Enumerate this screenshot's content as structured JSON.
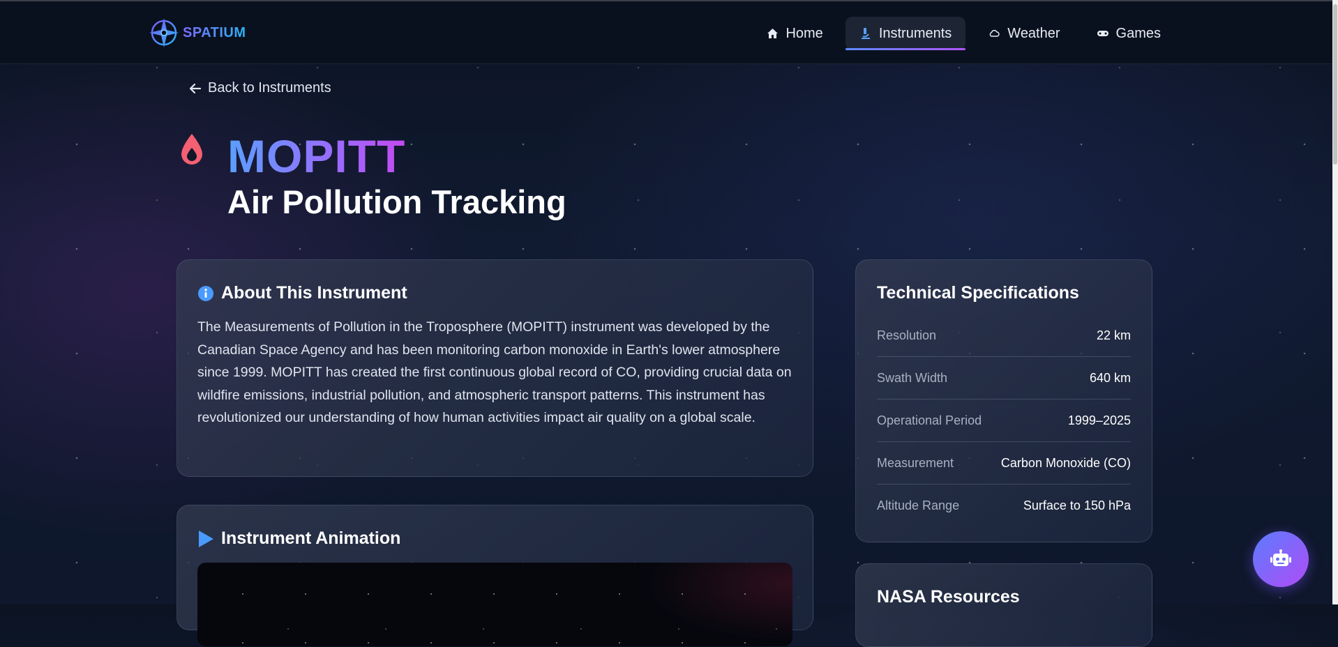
{
  "brand": {
    "name": "SPATIUM"
  },
  "nav": {
    "items": [
      {
        "label": "Home",
        "icon": "home-icon"
      },
      {
        "label": "Instruments",
        "icon": "microscope-icon",
        "active": true
      },
      {
        "label": "Weather",
        "icon": "cloud-icon"
      },
      {
        "label": "Games",
        "icon": "gamepad-icon"
      }
    ]
  },
  "back_link": {
    "label": "Back to Instruments"
  },
  "hero": {
    "title": "MOPITT",
    "subtitle": "Air Pollution Tracking",
    "icon": "droplet-icon"
  },
  "about": {
    "heading": "About This Instrument",
    "body": "The Measurements of Pollution in the Troposphere (MOPITT) instrument was developed by the Canadian Space Agency and has been monitoring carbon monoxide in Earth's lower atmosphere since 1999. MOPITT has created the first continuous global record of CO, providing crucial data on wildfire emissions, industrial pollution, and atmospheric transport patterns. This instrument has revolutionized our understanding of how human activities impact air quality on a global scale."
  },
  "animation": {
    "heading": "Instrument Animation"
  },
  "specs": {
    "heading": "Technical Specifications",
    "rows": [
      {
        "label": "Resolution",
        "value": "22 km"
      },
      {
        "label": "Swath Width",
        "value": "640 km"
      },
      {
        "label": "Operational Period",
        "value": "1999–2025"
      },
      {
        "label": "Measurement",
        "value": "Carbon Monoxide (CO)"
      },
      {
        "label": "Altitude Range",
        "value": "Surface to 150 hPa"
      }
    ]
  },
  "resources": {
    "heading": "NASA Resources"
  },
  "colors": {
    "accent_blue": "#5aa0ff",
    "accent_purple": "#b155ff",
    "droplet": "#f26071"
  }
}
